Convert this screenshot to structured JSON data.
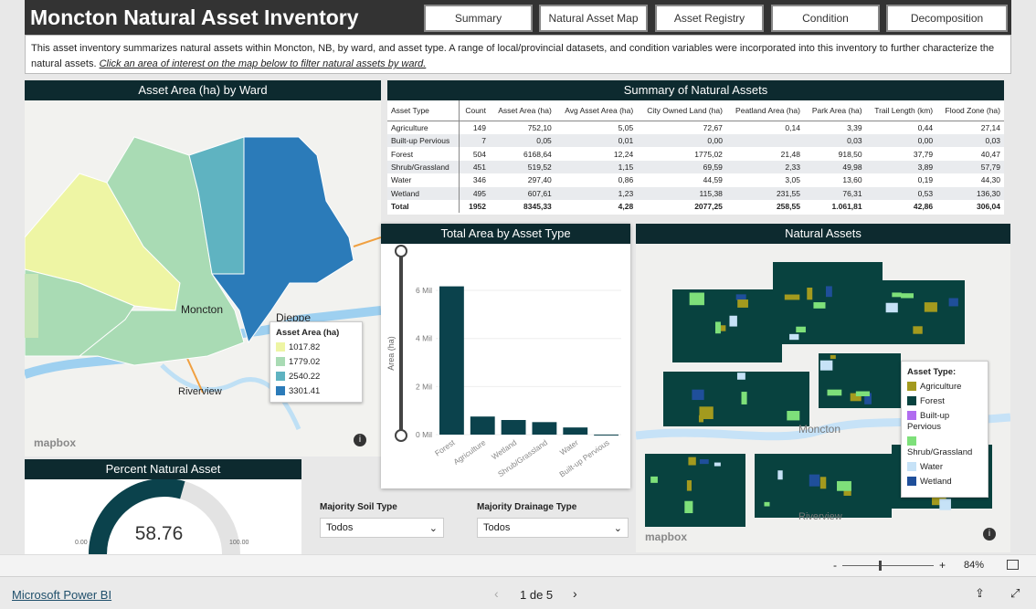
{
  "header": {
    "title": "Moncton Natural Asset Inventory",
    "nav": [
      "Summary",
      "Natural Asset Map",
      "Asset Registry",
      "Condition",
      "Decomposition"
    ]
  },
  "description": {
    "text": "This asset inventory summarizes natural assets within Moncton, NB, by ward, and asset type. A range of local/provincial datasets, and condition variables were incorporated into this inventory to further characterize the natural assets.",
    "link": "Click an area of interest on the map below to filter natural assets by ward."
  },
  "ward_map": {
    "title": "Asset Area (ha) by Ward",
    "labels": [
      "Moncton",
      "Dieppe",
      "Riverview"
    ],
    "attribution": "mapbox",
    "legend": {
      "title": "Asset Area (ha)",
      "items": [
        {
          "label": "1017.82",
          "color": "#eef5a4"
        },
        {
          "label": "1779.02",
          "color": "#a9dbb4"
        },
        {
          "label": "2540.22",
          "color": "#5fb3c1"
        },
        {
          "label": "3301.41",
          "color": "#2b7bb9"
        }
      ]
    }
  },
  "summary_table": {
    "title": "Summary of Natural Assets",
    "columns": [
      "Asset Type",
      "Count",
      "Asset Area (ha)",
      "Avg Asset Area (ha)",
      "City Owned Land (ha)",
      "Peatland Area (ha)",
      "Park Area (ha)",
      "Trail Length (km)",
      "Flood Zone (ha)"
    ],
    "rows": [
      [
        "Agriculture",
        "149",
        "752,10",
        "5,05",
        "72,67",
        "0,14",
        "3,39",
        "0,44",
        "27,14"
      ],
      [
        "Built-up Pervious",
        "7",
        "0,05",
        "0,01",
        "0,00",
        "",
        "0,03",
        "0,00",
        "0,03"
      ],
      [
        "Forest",
        "504",
        "6168,64",
        "12,24",
        "1775,02",
        "21,48",
        "918,50",
        "37,79",
        "40,47"
      ],
      [
        "Shrub/Grassland",
        "451",
        "519,52",
        "1,15",
        "69,59",
        "2,33",
        "49,98",
        "3,89",
        "57,79"
      ],
      [
        "Water",
        "346",
        "297,40",
        "0,86",
        "44,59",
        "3,05",
        "13,60",
        "0,19",
        "44,30"
      ],
      [
        "Wetland",
        "495",
        "607,61",
        "1,23",
        "115,38",
        "231,55",
        "76,31",
        "0,53",
        "136,30"
      ]
    ],
    "total": [
      "Total",
      "1952",
      "8345,33",
      "4,28",
      "2077,25",
      "258,55",
      "1.061,81",
      "42,86",
      "306,04"
    ]
  },
  "chart_data": {
    "type": "bar",
    "title": "Total Area by Asset Type",
    "xlabel": "",
    "ylabel": "Area (ha)",
    "categories": [
      "Forest",
      "Agriculture",
      "Wetland",
      "Shrub/Grassland",
      "Water",
      "Built-up Pervious"
    ],
    "values": [
      6168640,
      752100,
      607610,
      519520,
      297400,
      500
    ],
    "ylim": [
      0,
      6800000
    ],
    "ticks": [
      "0 Mil",
      "2 Mil",
      "4 Mil",
      "6 Mil"
    ],
    "tick_values": [
      0,
      2000000,
      4000000,
      6000000
    ],
    "color": "#0b424c",
    "grid": true
  },
  "gauge": {
    "title": "Percent Natural Asset",
    "value": "58.76",
    "fraction": 0.5876,
    "min": "0.00",
    "max": "100.00"
  },
  "slicers": [
    {
      "label": "Majority Soil Type",
      "value": "Todos"
    },
    {
      "label": "Majority Drainage Type",
      "value": "Todos"
    }
  ],
  "asset_map": {
    "title": "Natural Assets",
    "labels": [
      "Moncton",
      "Riverview"
    ],
    "attribution": "mapbox",
    "legend": {
      "title": "Asset Type:",
      "items": [
        {
          "label": "Agriculture",
          "color": "#a39a1e"
        },
        {
          "label": "Forest",
          "color": "#08423f"
        },
        {
          "label": "Built-up Pervious",
          "color": "#b06cf0"
        },
        {
          "label": "Shrub/Grassland",
          "color": "#7ee07a"
        },
        {
          "label": "Water",
          "color": "#c6e2f7"
        },
        {
          "label": "Wetland",
          "color": "#1f4f9a"
        }
      ]
    }
  },
  "zoom": {
    "minus": "-",
    "plus": "+",
    "level": "84%",
    "fraction": 0.4
  },
  "footer": {
    "brand": "Microsoft Power BI",
    "page": "1 de 5"
  }
}
